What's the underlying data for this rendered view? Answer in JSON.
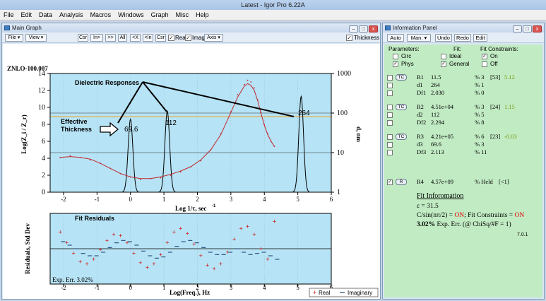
{
  "app": {
    "title": "Latest - Igor Pro 6.22A",
    "menus": [
      "File",
      "Edit",
      "Data",
      "Analysis",
      "Macros",
      "Windows",
      "Graph",
      "Misc",
      "Help"
    ]
  },
  "graph_window": {
    "title": "Main Graph",
    "toolbar": {
      "file": "File",
      "view": "View",
      "buttons": [
        "Csr",
        "In>",
        ">>",
        "All",
        "<X",
        "<In",
        "Csr"
      ],
      "real_label": "Rea",
      "imag_label": "Imag",
      "axis_label": "Axis",
      "thickness_label": "Thickness"
    },
    "sample_label": "ZNLO-100.007",
    "annotations": {
      "dielectric": "Dielectric Responses",
      "effective1": "Effective",
      "effective2": "Thickness",
      "fit_residuals": "Fit Residuals",
      "exp_err": "Exp. Err. 3.02%"
    },
    "peak_labels": [
      "69.6",
      "112",
      "264"
    ],
    "top_plot": {
      "ylabel": "Log(Z_i / Z_r)",
      "y2label": "d, nm",
      "xlabel": "Log 1/τ, sec",
      "xlabel_exp": "-1",
      "xticks": [
        "-2",
        "-1",
        "0",
        "1",
        "2",
        "3",
        "4",
        "5",
        "6"
      ],
      "yticks": [
        "0",
        "2",
        "4",
        "6",
        "8",
        "10",
        "12",
        "14"
      ],
      "y2ticks": [
        "1",
        "10",
        "100",
        "1000"
      ]
    },
    "bottom_plot": {
      "ylabel": "Residuals, Std Dev",
      "xlabel": "Log(Freq.), Hz",
      "xticks": [
        "-2",
        "-1",
        "0",
        "1",
        "2",
        "3",
        "4",
        "5",
        "6"
      ]
    },
    "legend": {
      "real": "Real",
      "imag": "Imaginary"
    }
  },
  "chart_data": [
    {
      "type": "line",
      "x": [
        -2.1,
        -1.8,
        -1.5,
        -1.2,
        -0.9,
        -0.6,
        -0.3,
        0.0,
        0.3,
        0.6,
        0.9,
        1.2,
        1.5,
        1.8,
        2.1,
        2.4,
        2.7,
        3.0,
        3.2,
        3.4,
        3.5,
        3.6,
        3.7,
        3.8,
        3.9,
        4.0,
        4.1,
        4.2,
        4.3
      ],
      "series": [
        {
          "values": [
            4.1,
            4.2,
            4.1,
            3.9,
            3.4,
            2.8,
            2.2,
            1.8,
            1.6,
            1.6,
            1.8,
            2.1,
            2.5,
            3.0,
            3.8,
            5.0,
            6.8,
            9.4,
            11.2,
            12.5,
            12.8,
            12.6,
            12.0,
            10.8,
            9.3,
            7.9,
            6.8,
            6.0,
            5.4
          ]
        },
        {
          "values": [
            4.1,
            4.3,
            4.1,
            3.8,
            3.4,
            2.8,
            2.2,
            1.8,
            1.5,
            1.6,
            1.7,
            2.0,
            2.4,
            3.0,
            3.7,
            5.0,
            6.9,
            9.5,
            11.5,
            12.7,
            13.2,
            13.0,
            12.3,
            10.9,
            9.4,
            8.0,
            6.9,
            6.0,
            5.4
          ]
        }
      ],
      "peaks": [
        {
          "x": 0.0,
          "d": 69.6
        },
        {
          "x": 1.1,
          "d": 112
        },
        {
          "x": 5.1,
          "d": 264
        }
      ],
      "xlabel": "Log 1/τ, sec-1",
      "ylabel": "Log(Z_i / Z_r)",
      "y2label": "d, nm",
      "xlim": [
        -2.4,
        6
      ],
      "ylim": [
        0,
        14
      ],
      "y2lim_log": [
        1,
        1000
      ],
      "grid": true
    },
    {
      "type": "scatter",
      "x": [
        -2.1,
        -1.9,
        -1.7,
        -1.5,
        -1.3,
        -1.1,
        -0.9,
        -0.7,
        -0.5,
        -0.3,
        -0.1,
        0.1,
        0.3,
        0.5,
        0.7,
        0.9,
        1.1,
        1.3,
        1.5,
        1.7,
        1.9,
        2.1,
        2.3,
        2.5,
        2.7,
        2.9,
        3.1,
        3.3,
        3.5,
        3.7,
        3.9,
        4.1,
        4.3
      ],
      "series": [
        {
          "name": "Real",
          "values": [
            1.4,
            0.5,
            -0.4,
            -1.1,
            -1.3,
            -0.9,
            -0.1,
            0.7,
            1.2,
            1.1,
            0.5,
            -0.4,
            -1.2,
            -1.6,
            -1.3,
            -0.5,
            0.5,
            1.4,
            1.7,
            1.3,
            0.4,
            -0.6,
            -1.4,
            -1.7,
            -1.3,
            -0.3,
            0.8,
            1.7,
            1.9,
            1.2,
            0.0,
            -0.9,
            2.3
          ]
        },
        {
          "name": "Imaginary",
          "values": [
            0.6,
            0.3,
            0.0,
            -0.4,
            -0.6,
            -0.6,
            -0.3,
            0.1,
            0.5,
            0.7,
            0.6,
            0.3,
            -0.2,
            -0.6,
            -0.8,
            -0.7,
            -0.3,
            0.2,
            0.6,
            0.7,
            0.5,
            0.1,
            -0.3,
            -0.5,
            -0.5,
            -0.3,
            0.0,
            -0.3,
            -0.5,
            -0.4,
            -0.3,
            -0.6,
            -0.9
          ]
        }
      ],
      "xlabel": "Log(Freq.), Hz",
      "ylabel": "Residuals, Std Dev",
      "xlim": [
        -2.4,
        6
      ],
      "ylim": [
        -3,
        3
      ],
      "legend": "bottom-right"
    }
  ],
  "info_panel": {
    "title": "Information Panel",
    "toolbar": [
      "Auto",
      "Man.",
      "Undo",
      "Redo",
      "Edit"
    ],
    "headers": {
      "params": "Parameters:",
      "fit": "Fit:",
      "constraints": "Fit Constraints:"
    },
    "options": {
      "circ": "Circ",
      "ideal": "Ideal",
      "on": "On",
      "phys": "Phys",
      "general": "General",
      "off": "Off"
    },
    "groups": [
      {
        "btn": "TC",
        "rows": [
          {
            "name": "R1",
            "value": "11.5",
            "pct": "% 3",
            "extra": "[53]",
            "green": "5.12"
          },
          {
            "name": "d1",
            "value": "264",
            "pct": "% 1",
            "extra": "",
            "green": ""
          },
          {
            "name": "Df1",
            "value": "2.030",
            "pct": "% 0",
            "extra": "",
            "green": ""
          }
        ]
      },
      {
        "btn": "TC",
        "rows": [
          {
            "name": "R2",
            "value": "4.51e+04",
            "pct": "% 3",
            "extra": "[24]",
            "green": "1.15"
          },
          {
            "name": "d2",
            "value": "112",
            "pct": "% 5",
            "extra": "",
            "green": ""
          },
          {
            "name": "Df2",
            "value": "2.294",
            "pct": "% 8",
            "extra": "",
            "green": ""
          }
        ]
      },
      {
        "btn": "TC",
        "rows": [
          {
            "name": "R3",
            "value": "4.21e+05",
            "pct": "% 6",
            "extra": "[23]",
            "green": "-0.03"
          },
          {
            "name": "d3",
            "value": "69.6",
            "pct": "% 3",
            "extra": "",
            "green": ""
          },
          {
            "name": "Df3",
            "value": "2.113",
            "pct": "% 11",
            "extra": "",
            "green": ""
          }
        ]
      }
    ],
    "r4": {
      "btn": "R",
      "name": "R4",
      "value": "4.57e+09",
      "pct": "% Held",
      "extra": "[<1]"
    },
    "fit_info": {
      "heading": "Fit Inforomation",
      "epsilon": "ε = 31.5",
      "line1_a": "C/sin(nπ/2) = ",
      "line1_b": "ON",
      "line1_c": ";  Fit Constraints = ",
      "line1_d": "ON",
      "line2_bold": "3.02%",
      "line2_rest": " Exp. Err. (@ ChiSq/#F = 1)",
      "version": "7.0.1"
    }
  }
}
